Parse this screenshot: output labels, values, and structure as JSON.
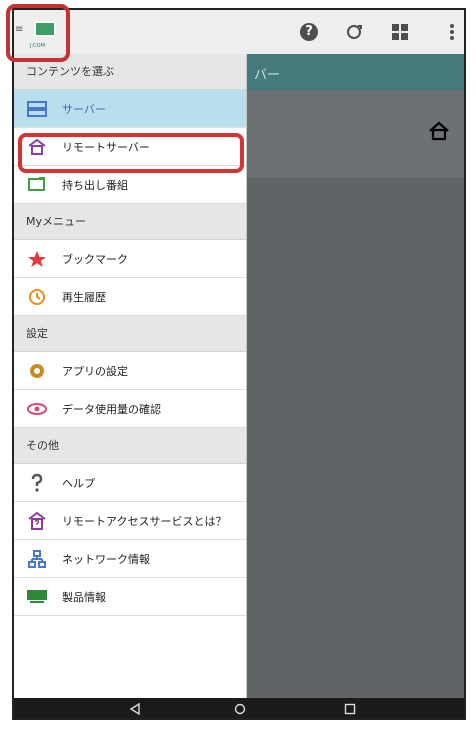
{
  "app": {
    "logo_text": "J:COM"
  },
  "topbar": {
    "help_icon": "help-circle-icon",
    "refresh_icon": "refresh-icon",
    "grid_icon": "grid-icon",
    "more_icon": "more-vert-icon",
    "help_glyph": "?"
  },
  "content": {
    "title_fragment": "バー"
  },
  "drawer": {
    "sections": [
      {
        "title": "コンテンツを選ぶ",
        "items": [
          {
            "label": "サーバー",
            "icon": "server-icon",
            "selected": true
          },
          {
            "label": "リモートサーバー",
            "icon": "remote-home-icon",
            "selected": false
          },
          {
            "label": "持ち出し番組",
            "icon": "monitor-icon",
            "selected": false
          }
        ]
      },
      {
        "title": "Myメニュー",
        "items": [
          {
            "label": "ブックマーク",
            "icon": "star-icon"
          },
          {
            "label": "再生履歴",
            "icon": "history-icon"
          }
        ]
      },
      {
        "title": "設定",
        "items": [
          {
            "label": "アプリの設定",
            "icon": "gear-icon"
          },
          {
            "label": "データ使用量の確認",
            "icon": "eye-icon"
          }
        ]
      },
      {
        "title": "その他",
        "items": [
          {
            "label": "ヘルプ",
            "icon": "question-icon"
          },
          {
            "label": "リモートアクセスサービスとは？",
            "icon": "remote-question-icon"
          },
          {
            "label": "ネットワーク情報",
            "icon": "network-icon"
          },
          {
            "label": "製品情報",
            "icon": "dw-logo-icon"
          }
        ]
      }
    ]
  },
  "colors": {
    "accent_red": "#d33434",
    "selected_bg": "#b9dfee",
    "teal": "#447a7c"
  }
}
